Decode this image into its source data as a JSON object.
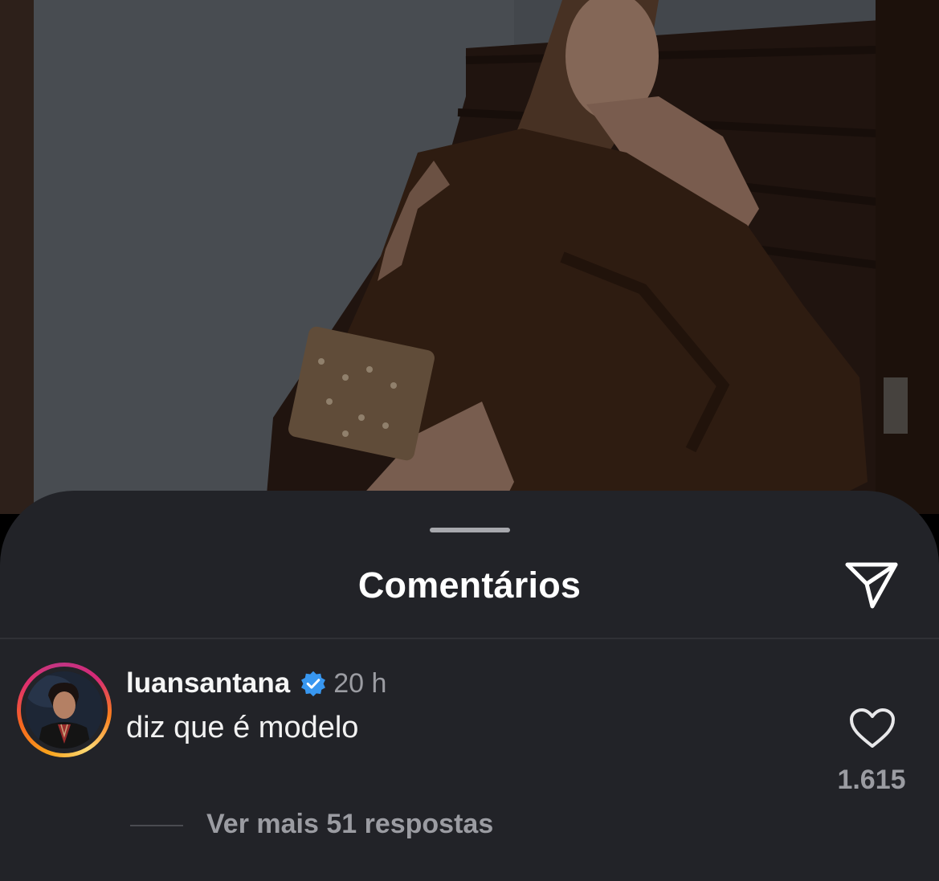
{
  "sheet": {
    "title": "Comentários",
    "share_icon": "paper-plane-icon"
  },
  "comment": {
    "username": "luansantana",
    "verified_icon": "verified-badge-icon",
    "time": "20 h",
    "text": "diz que é modelo",
    "like_icon": "heart-outline-icon",
    "likes": "1.615",
    "replies_link": "Ver mais 51 respostas"
  },
  "colors": {
    "sheet_bg": "#222328",
    "text_primary": "#ffffff",
    "text_secondary": "#9b9ca2",
    "verified_blue": "#3897f0"
  }
}
